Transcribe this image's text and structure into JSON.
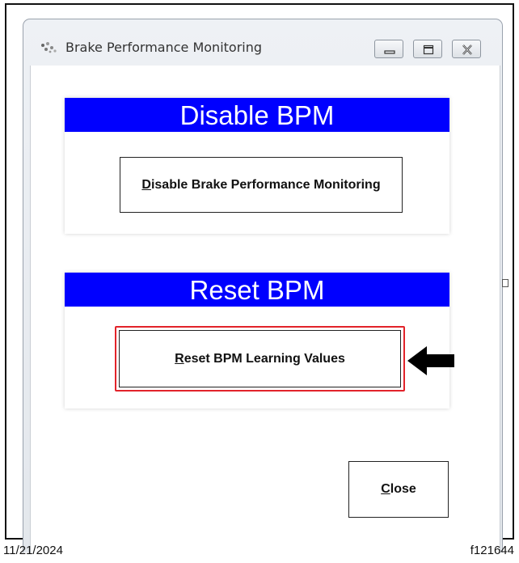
{
  "window": {
    "title": "Brake Performance Monitoring",
    "controls": {
      "minimize": "minimize-icon",
      "maximize": "maximize-icon",
      "close": "close-icon"
    }
  },
  "disable_group": {
    "header": "Disable BPM",
    "button": {
      "mnemonic": "D",
      "label_rest": "isable Brake Performance Monitoring"
    }
  },
  "reset_group": {
    "header": "Reset BPM",
    "button": {
      "mnemonic": "R",
      "label_rest": "eset BPM Learning Values"
    }
  },
  "close_button": {
    "mnemonic": "C",
    "label_rest": "lose"
  },
  "footer": {
    "date": "11/21/2024",
    "figure_id": "f121644"
  },
  "colors": {
    "header_blue": "#0000ff",
    "highlight_red": "#e2232a"
  }
}
